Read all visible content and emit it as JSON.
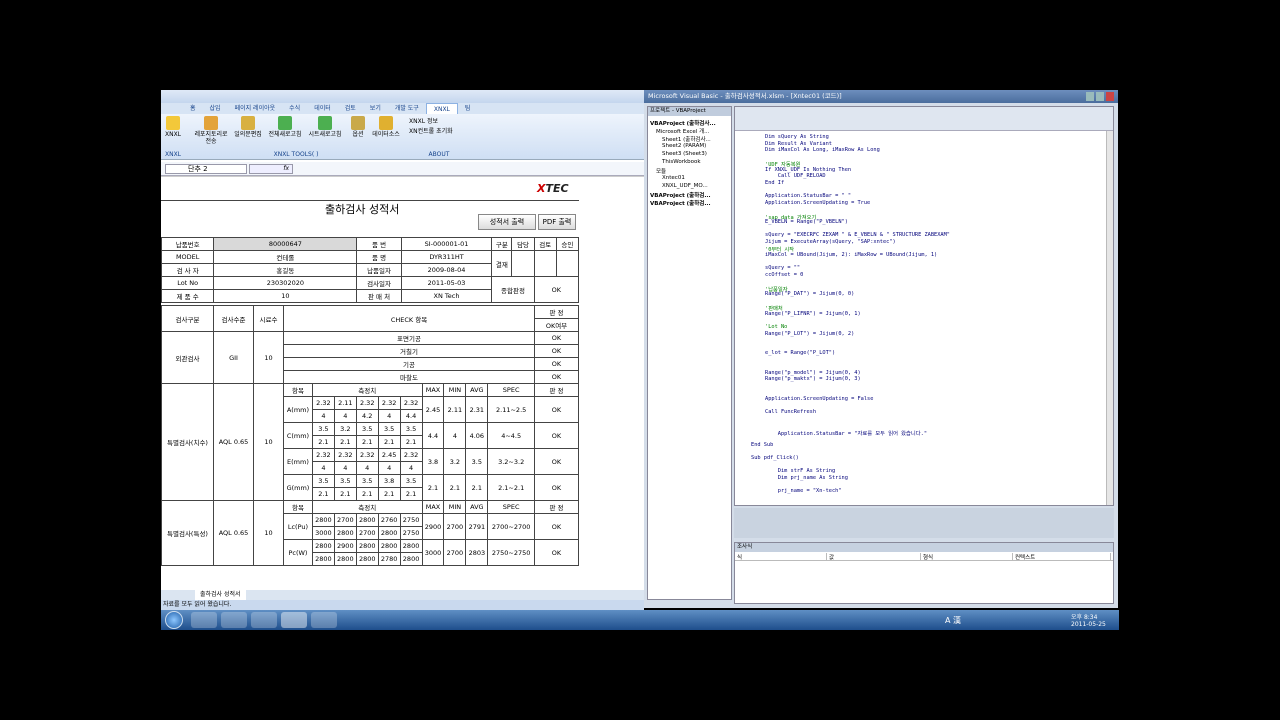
{
  "excel": {
    "tabs": [
      "홈",
      "삽입",
      "페이지 레이아웃",
      "수식",
      "데이터",
      "검토",
      "보기",
      "개발 도구",
      "XNXL",
      "팀"
    ],
    "active_tab": "XNXL",
    "ribbon": {
      "xnxl_btn": "XNXL",
      "btn1": "레포지토리로 전송",
      "btn2": "일의문편집",
      "btn3": "전체새로고침",
      "btn4": "시트새로고침",
      "btn5": "옵션",
      "btn6": "데이터소스",
      "info1": "XNXL 정보",
      "info2": "XN컨트롤 초기화",
      "group1": "XNXL",
      "group2": "XNXL TOOLS( )",
      "group3": "ABOUT"
    },
    "name_box": "단추 2",
    "fx": "fx",
    "sheet_tab": "출하검사 성적서",
    "status": "자료를 모두 읽어 왔습니다."
  },
  "report": {
    "logo_x": "X",
    "logo_rest": "TEC",
    "title": "출하검사 성적서",
    "btn_print": "성적서 출력",
    "btn_pdf": "PDF 출력",
    "h": {
      "l1": "납품번호",
      "v1": "80000647",
      "l2": "품 번",
      "v2": "SI-000001-01",
      "l3": "MODEL",
      "v3": "컨테롤",
      "l4": "품 명",
      "v4": "DYR311HT",
      "l5": "검 사 자",
      "v5": "홍길동",
      "l6": "납품일자",
      "v6": "2009-08-04",
      "l7": "Lot No",
      "v7": "230302020",
      "l8": "검사일자",
      "v8": "2011-05-03",
      "l9": "제 품 수",
      "v9": "10",
      "l10": "판 매 처",
      "v10": "XN Tech",
      "gubun": "구분",
      "dam": "담당",
      "geom": "검토",
      "seung": "승인",
      "gyeol": "결재",
      "total": "종합판정",
      "total_v": "OK"
    },
    "c": {
      "gubun": "검사구분",
      "sujun": "검사수준",
      "sample": "시료수",
      "check": "CHECK 항목",
      "pan": "판 정",
      "okyn": "OK여부"
    },
    "vis": {
      "name": "외관검사",
      "level": "GII",
      "n": "10",
      "items": [
        [
          "표면기공",
          "OK"
        ],
        [
          "거칠기",
          "OK"
        ],
        [
          "기공",
          "OK"
        ],
        [
          "마찰도",
          "OK"
        ]
      ]
    },
    "m": {
      "hang": "항목",
      "meas": "측정치",
      "max": "MAX",
      "min": "MIN",
      "avg": "AVG",
      "spec": "SPEC",
      "pan": "판 정"
    },
    "s1": {
      "name": "특별검사(치수)",
      "level": "AQL 0.65",
      "n": "10",
      "rows": [
        {
          "item": "A(mm)",
          "r1": [
            "2.32",
            "2.11",
            "2.32",
            "2.32",
            "2.32"
          ],
          "r2": [
            "4",
            "4",
            "4.2",
            "4",
            "4.4"
          ],
          "max": "2.45",
          "min": "2.11",
          "avg": "2.31",
          "spec": "2.11~2.5",
          "res": "OK"
        },
        {
          "item": "C(mm)",
          "r1": [
            "3.5",
            "3.2",
            "3.5",
            "3.5",
            "3.5"
          ],
          "r2": [
            "2.1",
            "2.1",
            "2.1",
            "2.1",
            "2.1"
          ],
          "max": "4.4",
          "min": "4",
          "avg": "4.06",
          "spec": "4~4.5",
          "res": "OK"
        },
        {
          "item": "E(mm)",
          "r1": [
            "2.32",
            "2.32",
            "2.32",
            "2.45",
            "2.32"
          ],
          "r2": [
            "4",
            "4",
            "4",
            "4",
            "4"
          ],
          "max": "3.8",
          "min": "3.2",
          "avg": "3.5",
          "spec": "3.2~3.2",
          "res": "OK"
        },
        {
          "item": "G(mm)",
          "r1": [
            "3.5",
            "3.5",
            "3.5",
            "3.8",
            "3.5"
          ],
          "r2": [
            "2.1",
            "2.1",
            "2.1",
            "2.1",
            "2.1"
          ],
          "max": "2.1",
          "min": "2.1",
          "avg": "2.1",
          "spec": "2.1~2.1",
          "res": "OK"
        }
      ]
    },
    "s2": {
      "name": "특별검사(특성)",
      "level": "AQL 0.65",
      "n": "10",
      "rows": [
        {
          "item": "Lc(Pu)",
          "r1": [
            "2800",
            "2700",
            "2800",
            "2760",
            "2750"
          ],
          "r2": [
            "3000",
            "2800",
            "2700",
            "2800",
            "2750"
          ],
          "max": "2900",
          "min": "2700",
          "avg": "2791",
          "spec": "2700~2700",
          "res": "OK"
        },
        {
          "item": "Pc(W)",
          "r1": [
            "2800",
            "2900",
            "2800",
            "2800",
            "2800"
          ],
          "r2": [
            "2800",
            "2800",
            "2800",
            "2780",
            "2800"
          ],
          "max": "3000",
          "min": "2700",
          "avg": "2803",
          "spec": "2750~2750",
          "res": "OK"
        }
      ]
    }
  },
  "vba": {
    "title": "Microsoft Visual Basic - 출하검사성적서.xlsm - [Xntec01 (코드)]",
    "project_header": "프로젝트 - VBAProject",
    "tree": [
      "VBAProject (출하검사...",
      "Microsoft Excel 개...",
      "Sheet1 (출하검사...",
      "Sheet2 (PARAM)",
      "Sheet3 (Sheet3)",
      "ThisWorkbook",
      "모듈",
      "Xntec01",
      "XNXL_UDF_MO...",
      "VBAProject (출하검...",
      "VBAProject (출하검..."
    ],
    "code": [
      [
        "Dim sQuery As String",
        ""
      ],
      [
        "Dim Result As Variant",
        ""
      ],
      [
        "Dim iMaxCol As Long, iMaxRow As Long",
        ""
      ],
      [
        "",
        ""
      ],
      [
        "'UDF 자동복원",
        "c"
      ],
      [
        "If XNXL_UDF Is Nothing Then",
        ""
      ],
      [
        "    Call UDF_RELOAD",
        ""
      ],
      [
        "End If",
        ""
      ],
      [
        "",
        ""
      ],
      [
        "Application.StatusBar = \" \"",
        ""
      ],
      [
        "Application.ScreenUpdating = True",
        ""
      ],
      [
        "",
        ""
      ],
      [
        "'sap data 가져오기",
        "c"
      ],
      [
        "E_VBELN = Range(\"P_VBELN\")",
        ""
      ],
      [
        "",
        ""
      ],
      [
        "sQuery = \"EXECRFC ZEXAM \" & E_VBELN & \" STRUCTURE ZABEXAM\"",
        ""
      ],
      [
        "Jijum = ExecuteArray(sQuery, \"SAP:xntec\")",
        ""
      ],
      [
        "'0부터 시작",
        "c"
      ],
      [
        "iMaxCol = UBound(Jijum, 2): iMaxRow = UBound(Jijum, 1)",
        ""
      ],
      [
        "",
        ""
      ],
      [
        "sQuery = \"\"",
        ""
      ],
      [
        "ccOffset = 0",
        ""
      ],
      [
        "",
        ""
      ],
      [
        "'납품일자",
        "c"
      ],
      [
        "Range(\"P_DAT\") = Jijum(0, 0)",
        ""
      ],
      [
        "",
        ""
      ],
      [
        "'판매처",
        "c"
      ],
      [
        "Range(\"P_LIFNR\") = Jijum(0, 1)",
        ""
      ],
      [
        "",
        ""
      ],
      [
        "'Lot No",
        "c"
      ],
      [
        "Range(\"P_LOT\") = Jijum(0, 2)",
        ""
      ],
      [
        "",
        ""
      ],
      [
        "",
        ""
      ],
      [
        "e_lot = Range(\"P_LOT\")",
        ""
      ],
      [
        "",
        ""
      ],
      [
        "",
        ""
      ],
      [
        "Range(\"p_model\") = Jijum(0, 4)",
        ""
      ],
      [
        "Range(\"p_maktx\") = Jijum(0, 3)",
        ""
      ],
      [
        "",
        ""
      ],
      [
        "",
        ""
      ],
      [
        "Application.ScreenUpdating = False",
        ""
      ],
      [
        "",
        ""
      ],
      [
        "Call FuncRefresh",
        ""
      ],
      [
        "",
        ""
      ],
      [
        "",
        ""
      ],
      [
        "    Application.StatusBar = \"자료를 모두 읽어 왔습니다.\"",
        ""
      ],
      [
        "",
        ""
      ],
      [
        "End Sub",
        ""
      ],
      [
        "",
        ""
      ],
      [
        "Sub pdf_Click()",
        ""
      ],
      [
        "",
        ""
      ],
      [
        "    Dim strF As String",
        ""
      ],
      [
        "    Dim prj_name As String",
        ""
      ],
      [
        "",
        ""
      ],
      [
        "    prj_name = \"Xn-tech\"",
        ""
      ]
    ],
    "watch_title": "조사식",
    "watch_cols": [
      "식",
      "값",
      "형식",
      "컨텍스트"
    ]
  },
  "taskbar": {
    "lang": "A 漢",
    "time": "오후 8:34",
    "date": "2011-05-25"
  }
}
